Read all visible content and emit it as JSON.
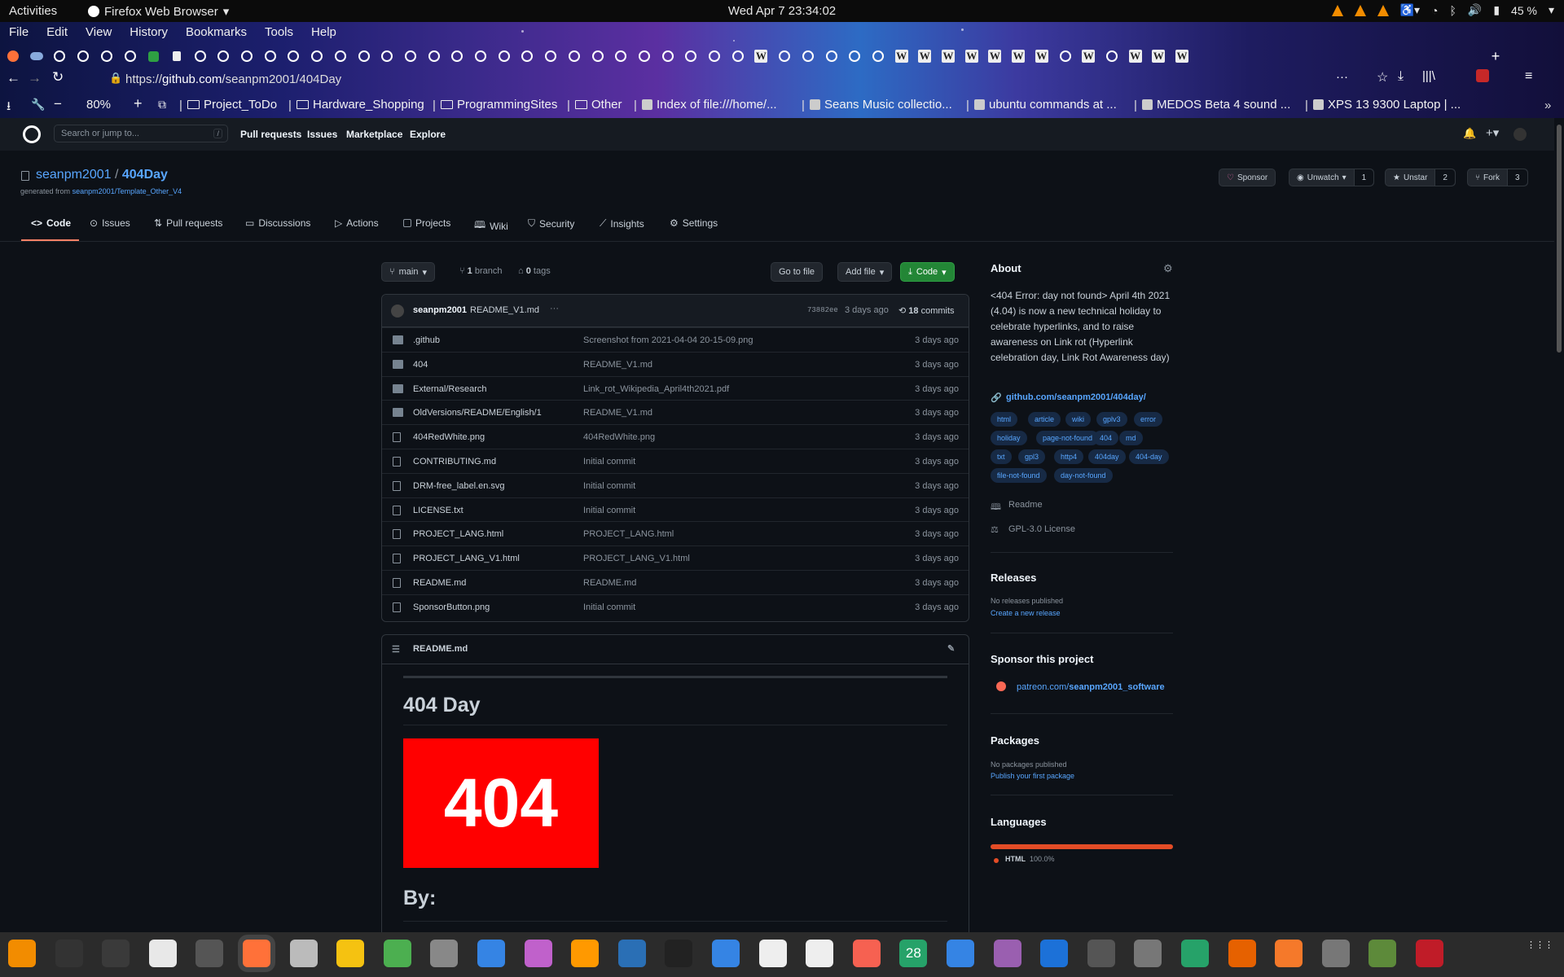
{
  "system": {
    "activities": "Activities",
    "app": "Firefox Web Browser",
    "clock": "Wed Apr 7  23:34:02",
    "battery": "45 %"
  },
  "menu": [
    "File",
    "Edit",
    "View",
    "History",
    "Bookmarks",
    "Tools",
    "Help"
  ],
  "nav": {
    "url_prefix": "https://",
    "url_domain": "github.com",
    "url_path": "/seanpm2001/404Day",
    "zoom": "80%"
  },
  "bookmarks": [
    "Project_ToDo",
    "Hardware_Shopping",
    "ProgrammingSites",
    "Other",
    "Index of file:///home/...",
    "Seans Music collectio...",
    "ubuntu commands at ...",
    "MEDOS Beta 4 sound ...",
    "XPS 13 9300 Laptop | ..."
  ],
  "github_header": {
    "search_placeholder": "Search or jump to...",
    "slash": "/",
    "nav": [
      "Pull requests",
      "Issues",
      "Marketplace",
      "Explore"
    ]
  },
  "repo": {
    "owner": "seanpm2001",
    "sep": "/",
    "name": "404Day",
    "generated_from_label": "generated from",
    "generated_from": "seanpm2001/Template_Other_V4",
    "sponsor": "Sponsor",
    "unwatch": "Unwatch",
    "watch_count": "1",
    "unstar": "Unstar",
    "star_count": "2",
    "fork": "Fork",
    "fork_count": "3",
    "tabs": [
      "Code",
      "Issues",
      "Pull requests",
      "Discussions",
      "Actions",
      "Projects",
      "Wiki",
      "Security",
      "Insights",
      "Settings"
    ]
  },
  "toolbar": {
    "branch": "main",
    "branches_n": "1",
    "branches_label": "branch",
    "tags_n": "0",
    "tags_label": "tags",
    "goto": "Go to file",
    "addfile": "Add file",
    "code": "Code"
  },
  "commit": {
    "author": "seanpm2001",
    "message": "README_V1.md",
    "ellipsis": "···",
    "sha": "73882ee",
    "when": "3 days ago",
    "commits_n": "18",
    "commits_label": "commits"
  },
  "files": [
    {
      "name": ".github",
      "type": "dir",
      "msg": "Screenshot from 2021-04-04 20-15-09.png",
      "age": "3 days ago"
    },
    {
      "name": "404",
      "type": "dir",
      "msg": "README_V1.md",
      "age": "3 days ago"
    },
    {
      "name": "External/Research",
      "type": "dir",
      "msg": "Link_rot_Wikipedia_April4th2021.pdf",
      "age": "3 days ago"
    },
    {
      "name": "OldVersions/README/English/1",
      "type": "dir",
      "msg": "README_V1.md",
      "age": "3 days ago"
    },
    {
      "name": "404RedWhite.png",
      "type": "file",
      "msg": "404RedWhite.png",
      "age": "3 days ago"
    },
    {
      "name": "CONTRIBUTING.md",
      "type": "file",
      "msg": "Initial commit",
      "age": "3 days ago"
    },
    {
      "name": "DRM-free_label.en.svg",
      "type": "file",
      "msg": "Initial commit",
      "age": "3 days ago"
    },
    {
      "name": "LICENSE.txt",
      "type": "file",
      "msg": "Initial commit",
      "age": "3 days ago"
    },
    {
      "name": "PROJECT_LANG.html",
      "type": "file",
      "msg": "PROJECT_LANG.html",
      "age": "3 days ago"
    },
    {
      "name": "PROJECT_LANG_V1.html",
      "type": "file",
      "msg": "PROJECT_LANG_V1.html",
      "age": "3 days ago"
    },
    {
      "name": "README.md",
      "type": "file",
      "msg": "README.md",
      "age": "3 days ago"
    },
    {
      "name": "SponsorButton.png",
      "type": "file",
      "msg": "Initial commit",
      "age": "3 days ago"
    }
  ],
  "readme": {
    "filename": "README.md",
    "title": "404 Day",
    "image_text": "404",
    "by": "By:"
  },
  "about": {
    "heading": "About",
    "description": "<404 Error: day not found> April 4th 2021 (4.04) is now a new technical holiday to celebrate hyperlinks, and to raise awareness on Link rot (Hyperlink celebration day, Link Rot Awareness day)",
    "link": "github.com/seanpm2001/404day/",
    "topics": [
      "html",
      "article",
      "wiki",
      "gplv3",
      "error",
      "holiday",
      "page-not-found",
      "404",
      "md",
      "txt",
      "gpl3",
      "http4",
      "404day",
      "404-day",
      "file-not-found",
      "day-not-found"
    ],
    "readme": "Readme",
    "license": "GPL-3.0 License"
  },
  "releases": {
    "heading": "Releases",
    "none": "No releases published",
    "create": "Create a new release"
  },
  "sponsor": {
    "heading": "Sponsor this project",
    "link_prefix": "patreon.com/",
    "link_user": "seanpm2001_software"
  },
  "packages": {
    "heading": "Packages",
    "none": "No packages published",
    "publish": "Publish your first package"
  },
  "languages": {
    "heading": "Languages",
    "name": "HTML",
    "pct": "100.0%",
    "share": 1.0,
    "color": "#e34c26"
  },
  "dock_calendar": "28"
}
